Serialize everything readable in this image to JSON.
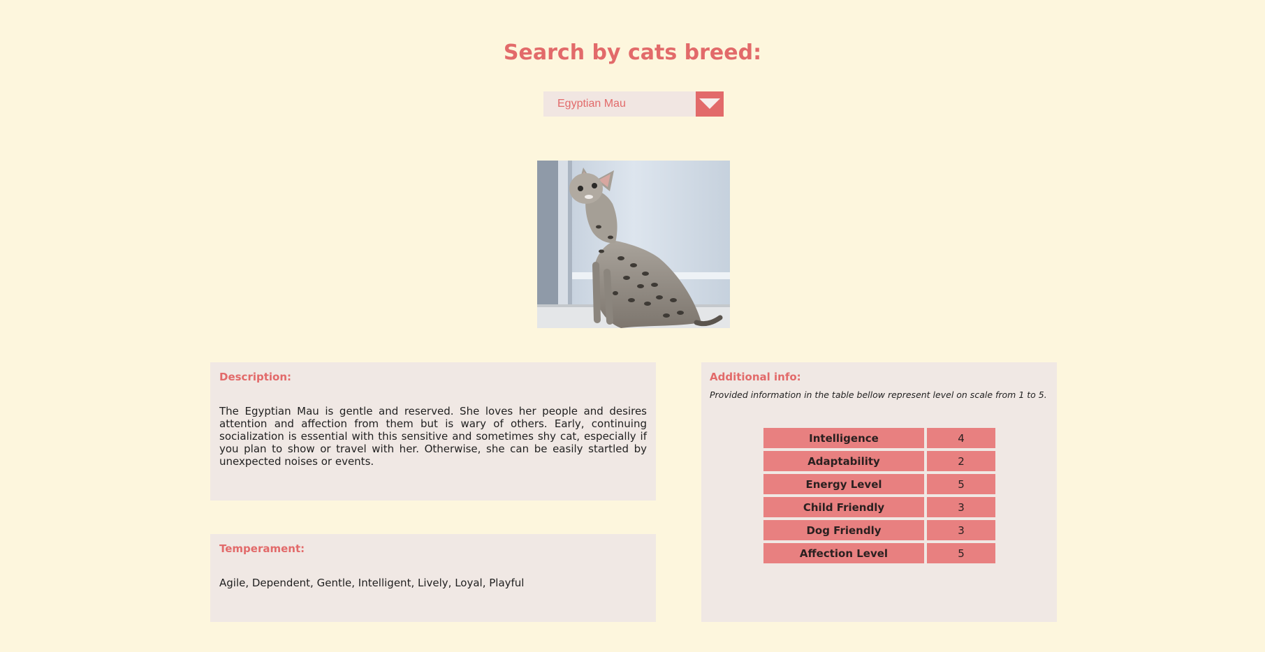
{
  "header": {
    "title": "Search by cats breed:"
  },
  "breed_select": {
    "selected": "Egyptian Mau",
    "arrow_icon": "triangle-down-icon"
  },
  "photo": {
    "alt": "Egyptian Mau"
  },
  "description": {
    "heading": "Description:",
    "text": "The Egyptian Mau is gentle and reserved. She loves her people and desires attention and affection from them but is wary of others. Early, continuing socialization is essential with this sensitive and sometimes shy cat, especially if you plan to show or travel with her. Otherwise, she can be easily startled by unexpected noises or events."
  },
  "temperament": {
    "heading": "Temperament:",
    "text": "Agile, Dependent, Gentle, Intelligent, Lively, Loyal, Playful"
  },
  "additional_info": {
    "heading": "Additional info:",
    "note": "Provided information in the table bellow represent level on scale from 1 to 5.",
    "rows": [
      {
        "label": "Intelligence",
        "value": "4"
      },
      {
        "label": "Adaptability",
        "value": "2"
      },
      {
        "label": "Energy Level",
        "value": "5"
      },
      {
        "label": "Child Friendly",
        "value": "3"
      },
      {
        "label": "Dog Friendly",
        "value": "3"
      },
      {
        "label": "Affection Level",
        "value": "5"
      }
    ]
  },
  "colors": {
    "background": "#fdf6dd",
    "accent": "#e26a6a",
    "panel": "#f0e8e4",
    "table_cell": "#e88080"
  }
}
